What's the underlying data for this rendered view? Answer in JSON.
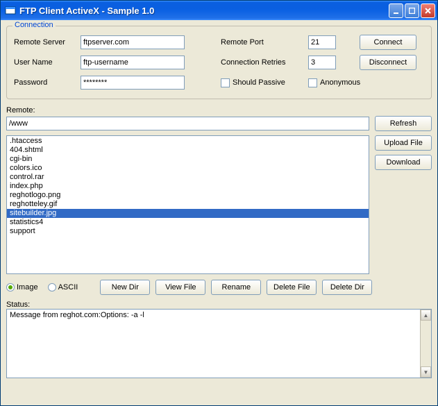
{
  "window": {
    "title": "FTP Client ActiveX - Sample 1.0"
  },
  "connection": {
    "legend": "Connection",
    "remoteServerLabel": "Remote Server",
    "remoteServerValue": "ftpserver.com",
    "userNameLabel": "User Name",
    "userNameValue": "ftp-username",
    "passwordLabel": "Password",
    "passwordValue": "********",
    "remotePortLabel": "Remote Port",
    "remotePortValue": "21",
    "connectionRetriesLabel": "Connection Retries",
    "connectionRetriesValue": "3",
    "shouldPassiveLabel": "Should Passive",
    "anonymousLabel": "Anonymous",
    "connectLabel": "Connect",
    "disconnectLabel": "Disconnect"
  },
  "remote": {
    "label": "Remote:",
    "pathValue": "/www",
    "refreshLabel": "Refresh",
    "uploadLabel": "Upload File",
    "downloadLabel": "Download",
    "files": [
      ".htaccess",
      "404.shtml",
      "cgi-bin",
      "colors.ico",
      "control.rar",
      "index.php",
      "reghotlogo.png",
      "reghotteley.gif",
      "sitebuilder.jpg",
      "statistics4",
      "support"
    ],
    "selectedIndex": 8
  },
  "transferMode": {
    "imageLabel": "Image",
    "asciiLabel": "ASCII",
    "selected": "image"
  },
  "actions": {
    "newDir": "New Dir",
    "viewFile": "View File",
    "rename": "Rename",
    "deleteFile": "Delete File",
    "deleteDir": "Delete Dir"
  },
  "status": {
    "label": "Status:",
    "text": "Message from reghot.com:Options: -a -l"
  }
}
